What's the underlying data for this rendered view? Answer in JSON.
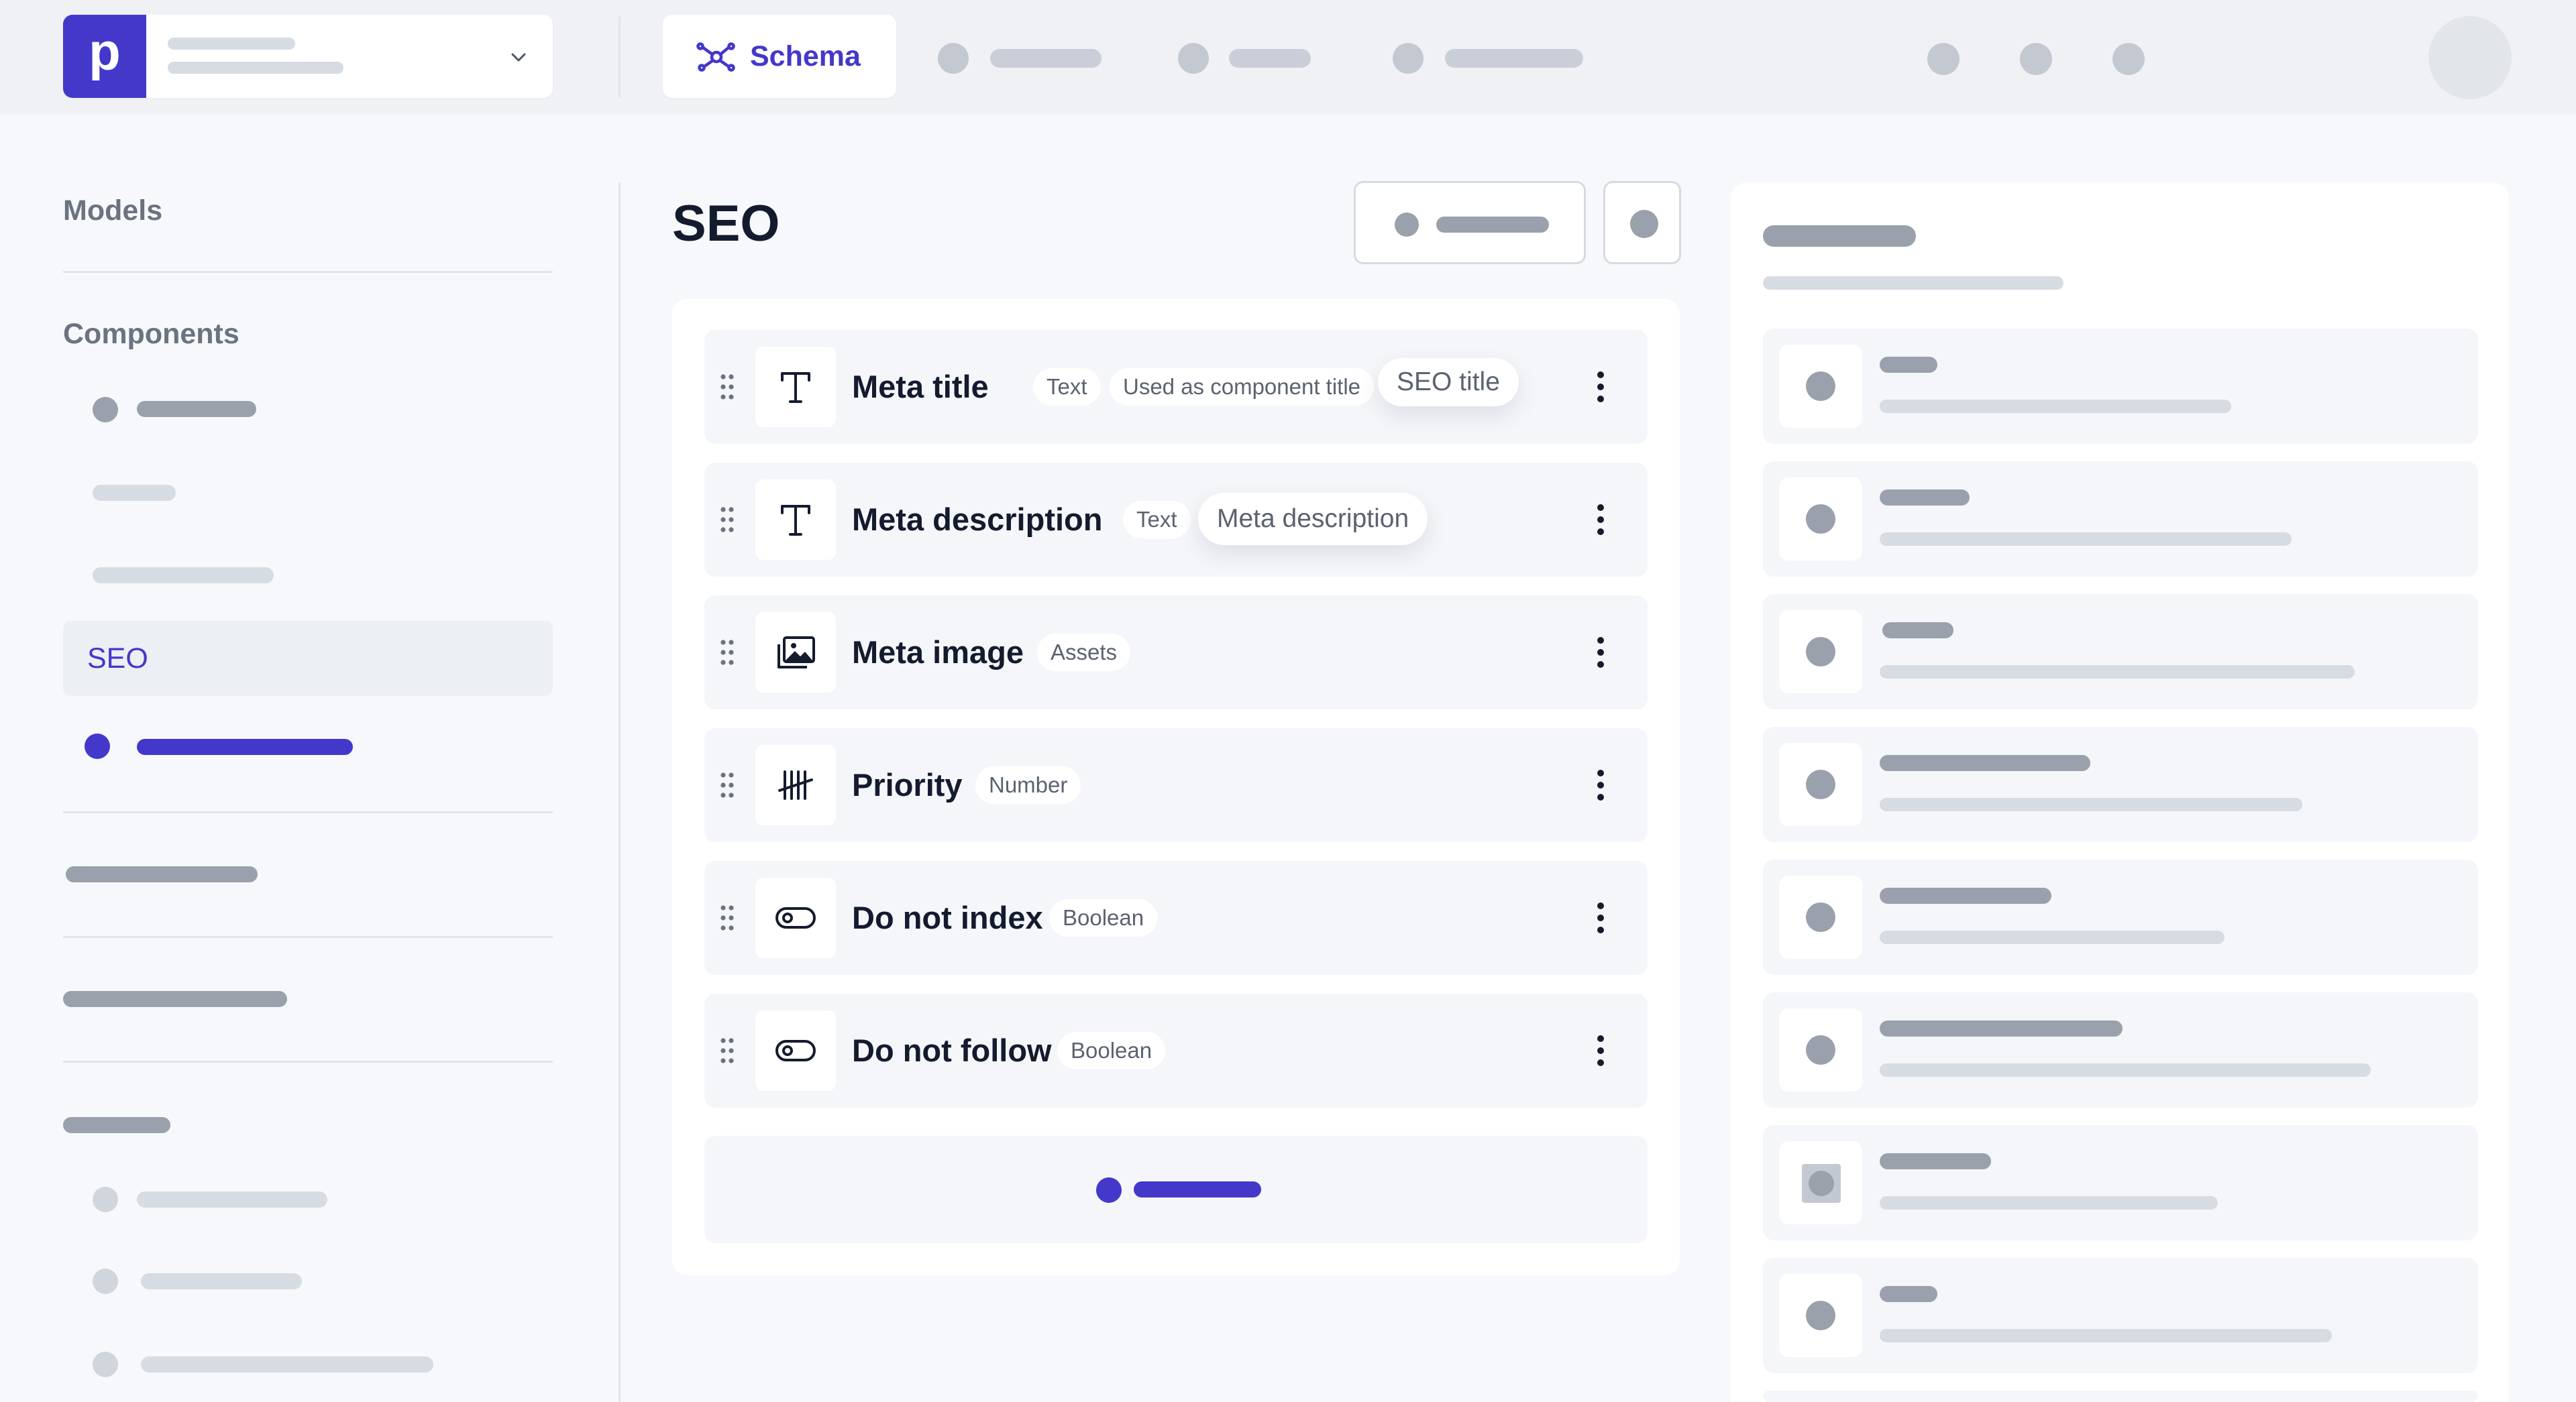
{
  "topbar": {
    "logo_letter": "p",
    "active_tab_label": "Schema"
  },
  "sidebar": {
    "models_heading": "Models",
    "components_heading": "Components",
    "selected_item": "SEO"
  },
  "main": {
    "title": "SEO",
    "fields": [
      {
        "name": "Meta title",
        "type": "Text",
        "note": "Used as component title",
        "tooltip": "SEO title",
        "icon": "text-type-icon"
      },
      {
        "name": "Meta description",
        "type": "Text",
        "tooltip": "Meta description",
        "icon": "text-type-icon"
      },
      {
        "name": "Meta image",
        "type": "Assets",
        "icon": "image-assets-icon"
      },
      {
        "name": "Priority",
        "type": "Number",
        "icon": "number-tally-icon"
      },
      {
        "name": "Do not index",
        "type": "Boolean",
        "icon": "toggle-icon"
      },
      {
        "name": "Do not follow",
        "type": "Boolean",
        "icon": "toggle-icon"
      }
    ]
  },
  "colors": {
    "accent": "#4338ca",
    "background": "#f6f8fb",
    "placeholder": "#9aa1ad"
  }
}
